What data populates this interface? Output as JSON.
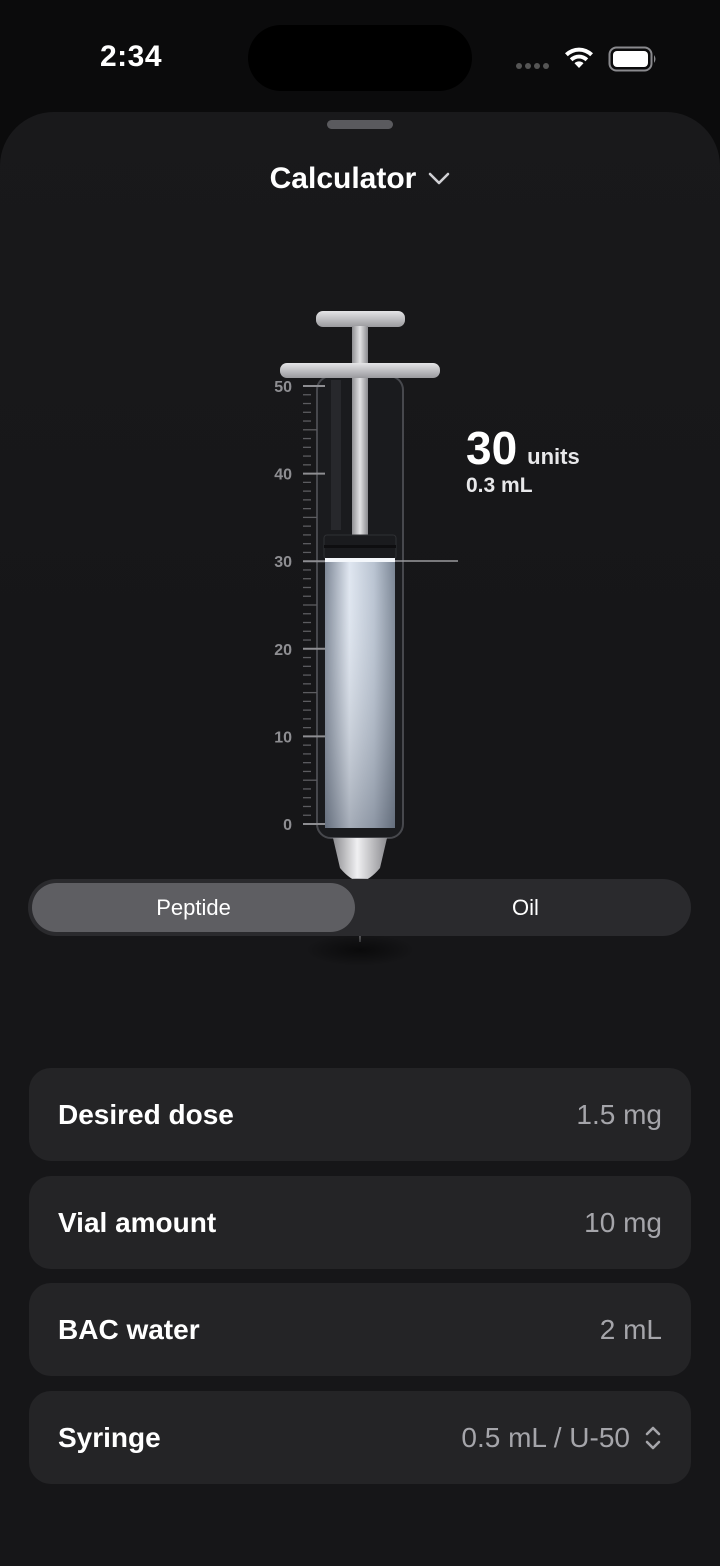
{
  "status_bar": {
    "time": "2:34"
  },
  "header": {
    "title": "Calculator"
  },
  "syringe": {
    "scale_max": 50,
    "ticks": [
      "50",
      "40",
      "30",
      "20",
      "10",
      "0"
    ],
    "fill_units": 30,
    "reading_value": "30",
    "reading_unit": "units",
    "reading_ml": "0.3 mL"
  },
  "mode": {
    "options": [
      "Peptide",
      "Oil"
    ],
    "selected": "Peptide"
  },
  "rows": [
    {
      "label": "Desired dose",
      "value": "1.5 mg"
    },
    {
      "label": "Vial amount",
      "value": "10 mg"
    },
    {
      "label": "BAC water",
      "value": "2 mL"
    },
    {
      "label": "Syringe",
      "value": "0.5 mL / U-50"
    }
  ]
}
